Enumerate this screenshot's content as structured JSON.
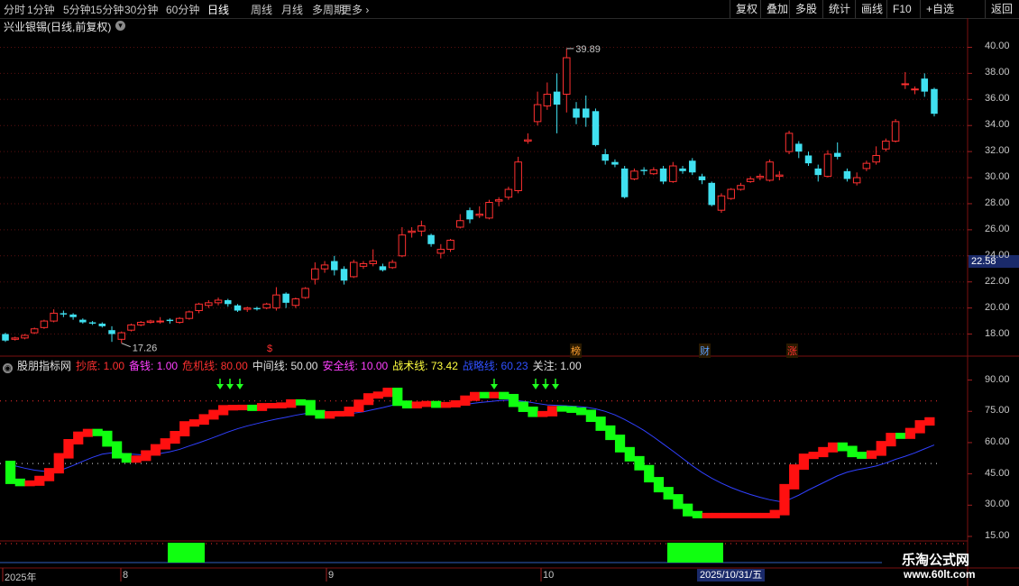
{
  "toolbar": {
    "periods": [
      "分时",
      "1分钟",
      "5分钟",
      "15分钟",
      "30分钟",
      "60分钟",
      "日线",
      "周线",
      "月线",
      "多周期",
      "更多"
    ],
    "active_period": "日线",
    "right_buttons": [
      "复权",
      "叠加",
      "多股",
      "统计",
      "画线",
      "F10",
      "+自选",
      "返回"
    ]
  },
  "stock": {
    "title": "兴业银锡(日线,前复权)",
    "last_price": "22.58",
    "high_marker": "39.89",
    "low_marker": "17.26"
  },
  "price_axis": [
    "40.00",
    "38.00",
    "36.00",
    "34.00",
    "32.00",
    "30.00",
    "28.00",
    "26.00",
    "24.00",
    "22.00",
    "20.00",
    "18.00"
  ],
  "events": [
    {
      "label": "$",
      "color": "#ff3030"
    },
    {
      "label": "榜",
      "color": "#ffa030"
    },
    {
      "label": "财",
      "color": "#5aa0ff"
    },
    {
      "label": "涨",
      "color": "#ff3030"
    }
  ],
  "indicator": {
    "name": "股朋指标网",
    "params": [
      {
        "label": "抄底: 1.00",
        "color": "#ff3030"
      },
      {
        "label": "备钱: 1.00",
        "color": "#ff40ff"
      },
      {
        "label": "危机线: 80.00",
        "color": "#ff3030"
      },
      {
        "label": "中间线: 50.00",
        "color": "#e0e0e0"
      },
      {
        "label": "安全线: 10.00",
        "color": "#ff40ff"
      },
      {
        "label": "战术线: 73.42",
        "color": "#ffff40"
      },
      {
        "label": "战略线: 60.23",
        "color": "#3050ff"
      },
      {
        "label": "关注: 1.00",
        "color": "#e0e0e0"
      }
    ],
    "axis": [
      "90.00",
      "75.00",
      "60.00",
      "45.00",
      "30.00",
      "15.00"
    ]
  },
  "dates": {
    "labels": [
      "2025年",
      "8",
      "9",
      "10"
    ],
    "cursor": "2025/10/31/五"
  },
  "watermark": {
    "name": "乐淘公式网",
    "url": "www.60lt.com"
  },
  "chart_data": {
    "type": "candlestick",
    "price_range": [
      17,
      41
    ],
    "candles": [
      [
        18.0,
        17.5,
        18.1,
        17.4
      ],
      [
        17.6,
        17.7,
        17.8,
        17.5
      ],
      [
        17.7,
        17.9,
        18.0,
        17.6
      ],
      [
        18.1,
        18.4,
        18.5,
        18.0
      ],
      [
        18.5,
        19.0,
        19.1,
        18.4
      ],
      [
        19.0,
        19.6,
        19.9,
        18.9
      ],
      [
        19.6,
        19.5,
        19.8,
        19.3
      ],
      [
        19.5,
        19.3,
        19.6,
        19.1
      ],
      [
        19.1,
        18.9,
        19.2,
        18.8
      ],
      [
        18.9,
        18.8,
        19.0,
        18.7
      ],
      [
        18.8,
        18.6,
        18.9,
        18.5
      ],
      [
        18.3,
        18.0,
        18.6,
        17.4
      ],
      [
        17.6,
        18.1,
        18.2,
        17.3
      ],
      [
        18.3,
        18.7,
        18.8,
        18.2
      ],
      [
        18.7,
        18.9,
        19.0,
        18.6
      ],
      [
        18.9,
        19.0,
        19.1,
        18.8
      ],
      [
        19.0,
        19.0,
        19.3,
        18.8
      ],
      [
        19.1,
        19.0,
        19.2,
        18.8
      ],
      [
        18.9,
        19.2,
        19.3,
        18.8
      ],
      [
        19.2,
        19.7,
        19.8,
        19.1
      ],
      [
        19.8,
        20.3,
        20.4,
        19.6
      ],
      [
        20.2,
        20.4,
        20.6,
        20.0
      ],
      [
        20.4,
        20.6,
        20.8,
        20.2
      ],
      [
        20.6,
        20.3,
        20.7,
        20.1
      ],
      [
        20.2,
        19.8,
        20.3,
        19.7
      ],
      [
        19.9,
        20.0,
        20.1,
        19.7
      ],
      [
        20.0,
        19.9,
        20.1,
        19.8
      ],
      [
        20.0,
        20.3,
        20.4,
        19.9
      ],
      [
        20.0,
        21.0,
        21.6,
        19.8
      ],
      [
        21.1,
        20.4,
        21.2,
        20.0
      ],
      [
        20.2,
        20.7,
        20.8,
        20.0
      ],
      [
        20.8,
        21.5,
        21.6,
        20.7
      ],
      [
        22.2,
        23.0,
        23.5,
        21.8
      ],
      [
        23.0,
        23.3,
        23.6,
        22.7
      ],
      [
        23.6,
        22.9,
        24.0,
        22.5
      ],
      [
        23.0,
        22.1,
        23.2,
        21.8
      ],
      [
        22.4,
        23.5,
        23.7,
        22.3
      ],
      [
        23.2,
        23.4,
        23.6,
        23.0
      ],
      [
        23.4,
        23.6,
        24.5,
        23.2
      ],
      [
        23.2,
        22.9,
        23.4,
        22.8
      ],
      [
        23.1,
        23.5,
        23.7,
        23.0
      ],
      [
        24.0,
        25.6,
        26.2,
        23.9
      ],
      [
        25.8,
        25.9,
        26.2,
        25.4
      ],
      [
        25.9,
        26.3,
        26.7,
        25.5
      ],
      [
        25.6,
        24.9,
        25.7,
        24.7
      ],
      [
        24.2,
        24.5,
        24.9,
        23.8
      ],
      [
        24.5,
        25.2,
        25.3,
        24.3
      ],
      [
        26.2,
        26.7,
        27.2,
        26.1
      ],
      [
        27.5,
        26.8,
        27.7,
        26.5
      ],
      [
        27.1,
        27.2,
        27.8,
        26.9
      ],
      [
        26.9,
        28.1,
        28.3,
        26.8
      ],
      [
        28.2,
        28.3,
        28.5,
        27.8
      ],
      [
        28.5,
        29.1,
        29.3,
        28.3
      ],
      [
        29.0,
        31.2,
        31.6,
        28.8
      ],
      [
        32.8,
        32.9,
        33.4,
        32.6
      ],
      [
        34.3,
        35.6,
        36.6,
        34.0
      ],
      [
        35.5,
        36.4,
        37.3,
        35.2
      ],
      [
        36.6,
        35.6,
        38.0,
        33.4
      ],
      [
        36.4,
        39.2,
        39.9,
        35.0
      ],
      [
        35.3,
        34.6,
        35.8,
        34.1
      ],
      [
        35.3,
        34.6,
        36.3,
        33.9
      ],
      [
        35.1,
        32.5,
        35.3,
        32.4
      ],
      [
        31.8,
        31.3,
        32.2,
        31.0
      ],
      [
        31.2,
        31.0,
        31.4,
        30.8
      ],
      [
        30.7,
        28.5,
        30.9,
        28.4
      ],
      [
        29.9,
        30.5,
        30.7,
        29.8
      ],
      [
        30.6,
        30.5,
        30.8,
        30.2
      ],
      [
        30.3,
        30.6,
        30.8,
        30.2
      ],
      [
        30.7,
        29.7,
        30.9,
        29.5
      ],
      [
        29.7,
        30.9,
        31.2,
        29.6
      ],
      [
        30.7,
        30.5,
        30.9,
        30.3
      ],
      [
        31.3,
        30.4,
        31.5,
        30.2
      ],
      [
        30.1,
        29.8,
        30.3,
        29.5
      ],
      [
        29.6,
        27.9,
        29.7,
        27.8
      ],
      [
        27.5,
        28.6,
        28.8,
        27.3
      ],
      [
        28.4,
        29.1,
        29.2,
        28.3
      ],
      [
        29.1,
        29.4,
        29.6,
        29.0
      ],
      [
        29.7,
        29.9,
        30.1,
        29.6
      ],
      [
        30.0,
        30.1,
        30.3,
        29.8
      ],
      [
        29.8,
        31.2,
        31.4,
        29.7
      ],
      [
        30.1,
        30.2,
        30.5,
        29.8
      ],
      [
        32.0,
        33.4,
        33.6,
        31.8
      ],
      [
        32.6,
        32.0,
        32.8,
        31.5
      ],
      [
        31.7,
        31.1,
        32.0,
        30.9
      ],
      [
        30.7,
        30.2,
        31.0,
        29.7
      ],
      [
        30.1,
        31.8,
        32.1,
        30.0
      ],
      [
        31.9,
        31.6,
        32.7,
        31.4
      ],
      [
        30.5,
        29.9,
        30.7,
        29.7
      ],
      [
        29.6,
        30.0,
        30.4,
        29.4
      ],
      [
        30.7,
        31.1,
        31.3,
        30.5
      ],
      [
        31.2,
        31.7,
        32.4,
        31.0
      ],
      [
        32.2,
        32.8,
        33.0,
        32.0
      ],
      [
        32.8,
        34.3,
        34.5,
        32.7
      ],
      [
        37.2,
        37.2,
        38.1,
        36.8
      ],
      [
        36.8,
        36.8,
        37.0,
        36.4
      ],
      [
        37.6,
        36.6,
        38.0,
        36.2
      ],
      [
        36.8,
        34.9,
        36.9,
        34.7
      ]
    ],
    "indicator_range": [
      15,
      95
    ],
    "lines": {
      "danger": 80,
      "middle": 50
    }
  }
}
